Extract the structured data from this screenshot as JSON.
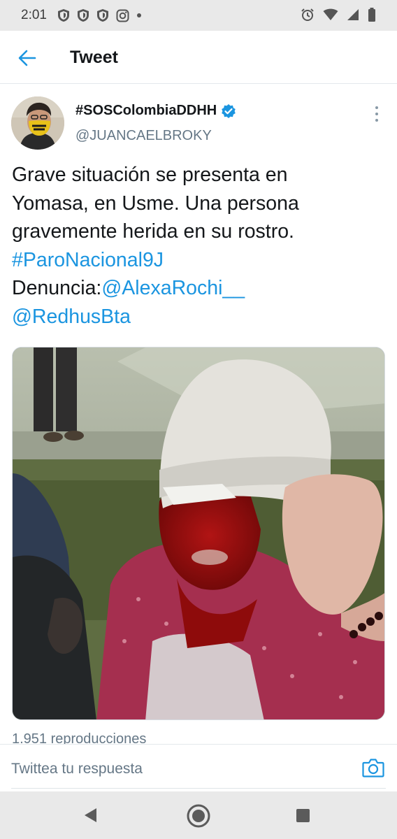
{
  "status_bar": {
    "time": "2:01",
    "left_icons": [
      "shield-icon",
      "shield-icon",
      "shield-icon",
      "instagram-icon",
      "dot-icon"
    ],
    "right_icons": [
      "alarm-icon",
      "wifi-icon",
      "signal-icon",
      "battery-icon"
    ]
  },
  "app_bar": {
    "title": "Tweet",
    "back_icon": "arrow-left-icon"
  },
  "tweet": {
    "display_name": "#SOSColombiaDDHH",
    "username": "@JUANCAELBROKY",
    "verified": true,
    "text_lines": [
      "Grave situación se presenta en",
      "Yomasa, en Usme. Una persona",
      "gravemente herida en su rostro."
    ],
    "hashtag": "#ParoNacional9J",
    "denuncia_label": "Denuncia:",
    "mention_1": "@AlexaRochi__",
    "mention_2": "@RedhusBta",
    "views": "1.951 reproducciones"
  },
  "reply": {
    "placeholder": "Twittea tu respuesta",
    "camera_icon": "camera-icon"
  },
  "nav": {
    "icons": [
      "back-triangle-icon",
      "home-circle-icon",
      "recents-square-icon"
    ]
  },
  "colors": {
    "accent": "#1b95e0",
    "text": "#14171a",
    "secondary": "#657786",
    "system_bar": "#e9e9e9"
  }
}
